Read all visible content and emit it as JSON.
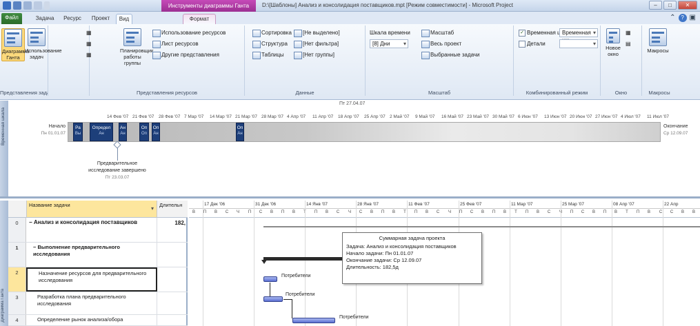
{
  "titlebar": {
    "context_title": "Инструменты диаграммы Ганта",
    "window_title": "D:\\[Шаблоны] Анализ и консолидация поставщиков.mpt [Режим совместимости] - Microsoft Project",
    "window_buttons": [
      "–",
      "□",
      "✕"
    ]
  },
  "tabs": [
    {
      "label": "Файл",
      "kind": "file"
    },
    {
      "label": "Задача",
      "kind": "normal"
    },
    {
      "label": "Ресурс",
      "kind": "normal"
    },
    {
      "label": "Проект",
      "kind": "normal"
    },
    {
      "label": "Вид",
      "kind": "active"
    },
    {
      "label": "Формат",
      "kind": "ctx"
    }
  ],
  "ribbon": {
    "groups": {
      "task_views": "Представления задач",
      "resource_views": "Представления ресурсов",
      "data": "Данные",
      "zoom": "Масштаб",
      "split_view": "Комбинированный режим",
      "window": "Окно",
      "macros": "Макросы"
    },
    "task_views": {
      "gantt": "Диаграмма Ганта",
      "usage": "Использование задач"
    },
    "resource_views": {
      "team_planner": "Планировщик работы группы",
      "resource_usage": "Использование ресурсов",
      "resource_sheet": "Лист ресурсов",
      "other_views": "Другие представления"
    },
    "data": {
      "sort": "Сортировка",
      "outline": "Структура",
      "tables": "Таблицы",
      "highlight": "[Не выделено]",
      "filter": "[Нет фильтра]",
      "group": "[Нет группы]"
    },
    "zoom": {
      "timescale_label": "Шкала времени",
      "timescale_value": "[8] Дни",
      "zoom": "Масштаб",
      "entire_project": "Весь проект",
      "selected_tasks": "Выбранные задачи"
    },
    "split_view": {
      "timeline": "Временная шкала",
      "timeline_value": "Временная шк",
      "details": "Детали"
    },
    "window": {
      "new_window": "Новое окно"
    },
    "macros": {
      "macros": "Макросы"
    }
  },
  "timeline": {
    "side_label": "Временная шкала",
    "today_label": "Пт 27.04.07",
    "date_ticks": [
      "14 Фев '07",
      "21 Фев '07",
      "28 Фев '07",
      "7 Мар '07",
      "14 Мар '07",
      "21 Мар '07",
      "28 Мар '07",
      "4 Апр '07",
      "11 Апр '07",
      "18 Апр '07",
      "25 Апр '07",
      "2 Май '07",
      "9 Май '07",
      "16 Май '07",
      "23 Май '07",
      "30 Май '07",
      "6 Июн '07",
      "13 Июн '07",
      "20 Июн '07",
      "27 Июн '07",
      "4 Июл '07",
      "11 Июл '07"
    ],
    "start_label": "Начало",
    "start_date": "Пн 01.01.07",
    "end_label": "Окончание",
    "end_date": "Ср 12.09.07",
    "tasks": [
      {
        "label": "Ра",
        "sub": "Вы"
      },
      {
        "label": "Определ",
        "sub": "Ан"
      },
      {
        "label": "Ан",
        "sub": "Ан"
      },
      {
        "label": "Оп",
        "sub": "Оп"
      },
      {
        "label": "Оп",
        "sub": "Ан"
      },
      {
        "label": "Оп",
        "sub": "Ан"
      }
    ],
    "callout_title": "Предварительное исследование завершено",
    "callout_date": "Пт 23.03.07"
  },
  "gantt": {
    "side_label": "Диаграмма Ганта",
    "headers": {
      "id": "",
      "name": "Название задачи",
      "duration": "Длительн"
    },
    "rows": [
      {
        "num": "0",
        "name": "Анализ и консолидация поставщиков",
        "duration": "182,",
        "summary": true
      },
      {
        "num": "1",
        "name": "Выполнение предварительного исследования",
        "duration": "",
        "summary": false,
        "subsummary": true
      },
      {
        "num": "2",
        "name": "Назначение ресурсов для предварительного исследования",
        "duration": "",
        "summary": false,
        "selected": true
      },
      {
        "num": "3",
        "name": "Разработка плана предварительного исследования",
        "duration": "",
        "summary": false
      },
      {
        "num": "4",
        "name": "Определение рынок анализа/обора",
        "duration": "",
        "summary": false
      }
    ],
    "timescale_top": [
      "17 Дек '06",
      "31 Дек '06",
      "14 Янв '07",
      "28 Янв '07",
      "11 Фев '07",
      "25 Фев '07",
      "11 Мар '07",
      "25 Мар '07",
      "08 Апр '07",
      "22 Апр"
    ],
    "timescale_bottom": [
      "В",
      "П",
      "В",
      "С",
      "Ч",
      "П",
      "С",
      "В",
      "П",
      "В",
      "Т",
      "П",
      "В",
      "С",
      "Ч",
      "С",
      "В",
      "П",
      "В",
      "Т",
      "П",
      "В",
      "С",
      "Ч",
      "П",
      "С",
      "В",
      "П",
      "В",
      "Т",
      "П",
      "В",
      "С",
      "Ч",
      "П",
      "С",
      "В",
      "П",
      "В",
      "Т",
      "П",
      "В",
      "С",
      "С",
      "В",
      "В"
    ],
    "resource_labels": [
      "Потребители",
      "Потребители",
      "Потребители"
    ],
    "tooltip": {
      "title": "Суммарная задача проекта",
      "task": "Задача: Анализ и консолидация поставщиков",
      "start": "Начало задачи: Пн 01.01.07",
      "finish": "Окончание задачи: Ср 12.09.07",
      "duration": "Длительность: 182,5д"
    }
  },
  "colors": {
    "context_tab": "#9b2f92",
    "file_tab": "#2a6b2a",
    "timeline_task": "#1d3f7a",
    "gantt_task": "#5b6fd3",
    "selection": "#fde69d"
  }
}
